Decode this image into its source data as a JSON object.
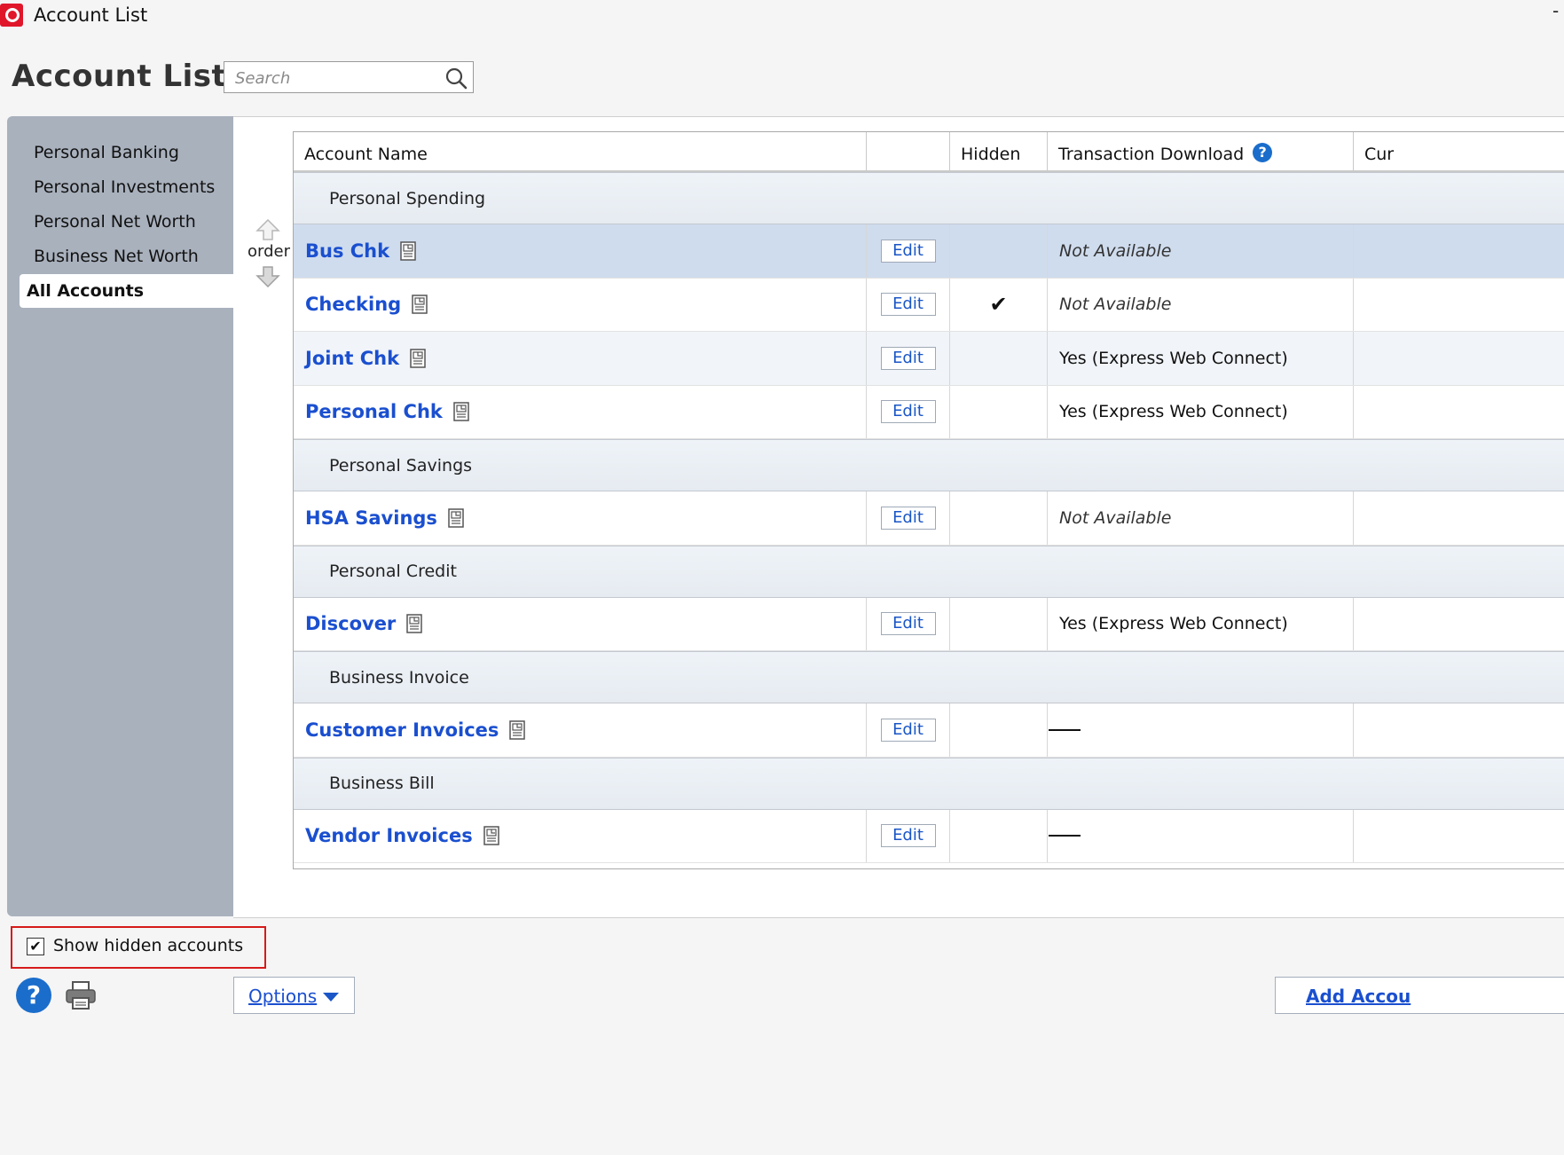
{
  "window": {
    "title": "Account List",
    "minimize_glyph": "-"
  },
  "header": {
    "title": "Account List",
    "search_placeholder": "Search"
  },
  "sidebar": {
    "items": [
      {
        "label": "Personal Banking",
        "active": false
      },
      {
        "label": "Personal Investments",
        "active": false
      },
      {
        "label": "Personal Net Worth",
        "active": false
      },
      {
        "label": "Business Net Worth",
        "active": false
      },
      {
        "label": "All Accounts",
        "active": true
      }
    ]
  },
  "order": {
    "label": "order"
  },
  "table": {
    "columns": [
      "Account Name",
      "",
      "Hidden",
      "Transaction Download",
      "Cur"
    ],
    "edit_label": "Edit",
    "rows": [
      {
        "type": "group",
        "label": "Personal Spending"
      },
      {
        "type": "account",
        "name": "Bus Chk",
        "hidden": false,
        "download": "Not Available",
        "download_style": "na",
        "selected": true
      },
      {
        "type": "account",
        "name": "Checking",
        "hidden": true,
        "download": "Not Available",
        "download_style": "na"
      },
      {
        "type": "account",
        "name": "Joint Chk",
        "hidden": false,
        "download": "Yes (Express Web Connect)",
        "download_style": "yes",
        "alt": true
      },
      {
        "type": "account",
        "name": "Personal Chk",
        "hidden": false,
        "download": "Yes (Express Web Connect)",
        "download_style": "yes"
      },
      {
        "type": "group",
        "label": "Personal Savings"
      },
      {
        "type": "account",
        "name": "HSA Savings",
        "hidden": false,
        "download": "Not Available",
        "download_style": "na"
      },
      {
        "type": "group",
        "label": "Personal Credit"
      },
      {
        "type": "account",
        "name": "Discover",
        "hidden": false,
        "download": "Yes (Express Web Connect)",
        "download_style": "yes"
      },
      {
        "type": "group",
        "label": "Business Invoice"
      },
      {
        "type": "account",
        "name": "Customer Invoices",
        "hidden": false,
        "download": "",
        "download_style": "dash"
      },
      {
        "type": "group",
        "label": "Business Bill"
      },
      {
        "type": "account",
        "name": "Vendor Invoices",
        "hidden": false,
        "download": "",
        "download_style": "dash"
      }
    ]
  },
  "footer": {
    "show_hidden_label": "Show hidden accounts",
    "show_hidden_checked": true,
    "options_label": "Options",
    "add_account_label": "Add Accou"
  },
  "icons": {
    "app": "quicken-logo-icon",
    "search": "search-icon",
    "help": "help-icon",
    "print": "printer-icon",
    "account": "account-report-icon"
  },
  "colors": {
    "link": "#1a4fcf",
    "selected_row": "#cfdcee",
    "highlight_border": "#d61a1a",
    "help": "#1a6dcb"
  }
}
